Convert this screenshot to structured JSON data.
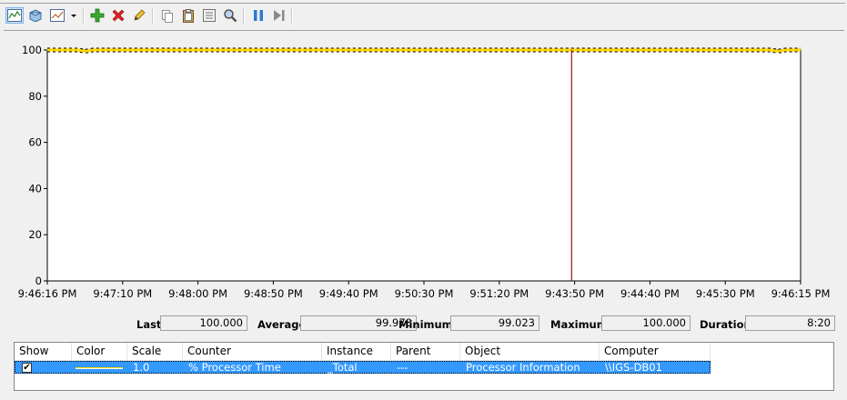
{
  "toolbar": {
    "buttons": [
      {
        "name": "view-graph-icon"
      },
      {
        "name": "view-current-activity-icon"
      },
      {
        "name": "change-graph-type-icon"
      },
      {
        "name": "add-counter-icon"
      },
      {
        "name": "delete-counter-icon"
      },
      {
        "name": "highlight-icon"
      },
      {
        "name": "copy-properties-icon"
      },
      {
        "name": "paste-counter-list-icon"
      },
      {
        "name": "properties-icon"
      },
      {
        "name": "zoom-icon"
      },
      {
        "name": "freeze-display-icon"
      },
      {
        "name": "update-data-icon"
      }
    ]
  },
  "chart_data": {
    "type": "line",
    "ylim": [
      0,
      100
    ],
    "yticks": [
      "0",
      "20",
      "40",
      "60",
      "80",
      "100"
    ],
    "xticks": [
      "9:46:16 PM",
      "9:47:10 PM",
      "9:48:00 PM",
      "9:48:50 PM",
      "9:49:40 PM",
      "9:50:30 PM",
      "9:51:20 PM",
      "9:43:50 PM",
      "9:44:40 PM",
      "9:45:30 PM",
      "9:46:15 PM"
    ],
    "series": [
      {
        "color": "#ffd700",
        "values": [
          100,
          100,
          100,
          100,
          100,
          99.5,
          100,
          100,
          100,
          100,
          100,
          100,
          100,
          100,
          100,
          100,
          100,
          100,
          100,
          100,
          100,
          100,
          100,
          100,
          100,
          100,
          100,
          100,
          100,
          100,
          100,
          100,
          100,
          100,
          100,
          100,
          100,
          100,
          100,
          100,
          100,
          100,
          100,
          100,
          100,
          100,
          100,
          100,
          100,
          100,
          100,
          100,
          100,
          100,
          100,
          100,
          100,
          100,
          100,
          100,
          100,
          100,
          100,
          100,
          100,
          100,
          100,
          100,
          100,
          100,
          100,
          100,
          100,
          100,
          100,
          100,
          100,
          100,
          100,
          100,
          100,
          100,
          100,
          100,
          100,
          100,
          100,
          100,
          100,
          100,
          100,
          100,
          100,
          100,
          100,
          100,
          99.5,
          100,
          100,
          100
        ]
      }
    ],
    "current_position_fraction": 0.696,
    "grid": false
  },
  "stats": {
    "last_label": "Last",
    "last_value": "100.000",
    "average_label": "Average",
    "average_value": "99.978",
    "minimum_label": "Minimum",
    "minimum_value": "99.023",
    "maximum_label": "Maximum",
    "maximum_value": "100.000",
    "duration_label": "Duration",
    "duration_value": "8:20"
  },
  "counter_list": {
    "headers": {
      "show": "Show",
      "color": "Color",
      "scale": "Scale",
      "counter": "Counter",
      "instance": "Instance",
      "parent": "Parent",
      "object": "Object",
      "computer": "Computer"
    },
    "rows": [
      {
        "show": "✔",
        "color": "#ffd700",
        "scale": "1.0",
        "counter": "% Processor Time",
        "instance": "_Total",
        "parent": "---",
        "object": "Processor Information",
        "computer": "\\\\IGS-DB01"
      }
    ]
  }
}
